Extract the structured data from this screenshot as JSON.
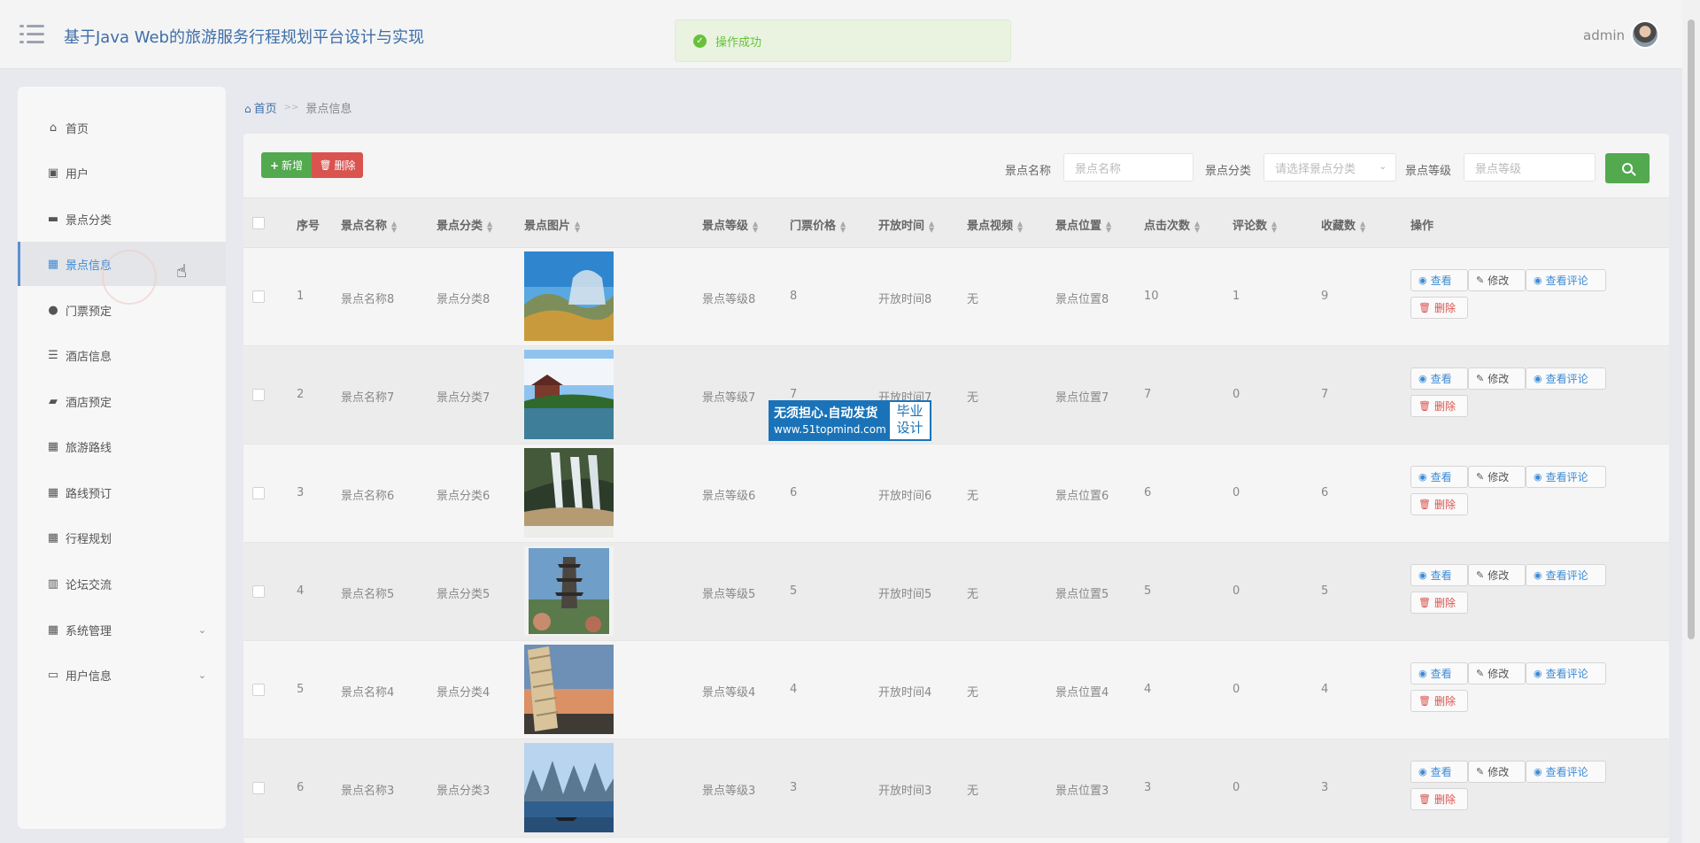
{
  "header": {
    "title": "基于Java Web的旅游服务行程规划平台设计与实现",
    "toast": "操作成功",
    "user": "admin"
  },
  "sidebar": {
    "items": [
      {
        "label": "首页",
        "icon": "home-icon",
        "glyph": "⌂"
      },
      {
        "label": "用户",
        "icon": "clipboard-icon",
        "glyph": "▣"
      },
      {
        "label": "景点分类",
        "icon": "monitor-icon",
        "glyph": "▬"
      },
      {
        "label": "景点信息",
        "icon": "grid-icon",
        "glyph": "▦",
        "active": true
      },
      {
        "label": "门票预定",
        "icon": "person-icon",
        "glyph": "●"
      },
      {
        "label": "酒店信息",
        "icon": "sliders-icon",
        "glyph": "☰"
      },
      {
        "label": "酒店预定",
        "icon": "ticket-icon",
        "glyph": "▰"
      },
      {
        "label": "旅游路线",
        "icon": "grid-icon",
        "glyph": "▦"
      },
      {
        "label": "路线预订",
        "icon": "grid-icon",
        "glyph": "▦"
      },
      {
        "label": "行程规划",
        "icon": "grid-icon",
        "glyph": "▦"
      },
      {
        "label": "论坛交流",
        "icon": "books-icon",
        "glyph": "▥"
      },
      {
        "label": "系统管理",
        "icon": "grid-icon",
        "glyph": "▦",
        "expandable": true
      },
      {
        "label": "用户信息",
        "icon": "card-icon",
        "glyph": "▭",
        "expandable": true
      }
    ]
  },
  "breadcrumb": {
    "home": "首页",
    "separator": ">>",
    "current": "景点信息"
  },
  "toolbar": {
    "add_label": "新增",
    "delete_label": "删除",
    "filters": [
      {
        "label": "景点名称",
        "placeholder": "景点名称"
      },
      {
        "label": "景点分类",
        "placeholder": "请选择景点分类"
      },
      {
        "label": "景点等级",
        "placeholder": "景点等级"
      }
    ]
  },
  "table": {
    "columns": [
      "序号",
      "景点名称",
      "景点分类",
      "景点图片",
      "景点等级",
      "门票价格",
      "开放时间",
      "景点视频",
      "景点位置",
      "点击次数",
      "评论数",
      "收藏数",
      "操作"
    ],
    "rows": [
      {
        "index": "1",
        "name": "景点名称8",
        "category": "景点分类8",
        "level": "景点等级8",
        "price": "8",
        "hours": "开放时间8",
        "video": "无",
        "location": "景点位置8",
        "clicks": "10",
        "comments": "1",
        "favorites": "9"
      },
      {
        "index": "2",
        "name": "景点名称7",
        "category": "景点分类7",
        "level": "景点等级7",
        "price": "7",
        "hours": "开放时间7",
        "video": "无",
        "location": "景点位置7",
        "clicks": "7",
        "comments": "0",
        "favorites": "7"
      },
      {
        "index": "3",
        "name": "景点名称6",
        "category": "景点分类6",
        "level": "景点等级6",
        "price": "6",
        "hours": "开放时间6",
        "video": "无",
        "location": "景点位置6",
        "clicks": "6",
        "comments": "0",
        "favorites": "6"
      },
      {
        "index": "4",
        "name": "景点名称5",
        "category": "景点分类5",
        "level": "景点等级5",
        "price": "5",
        "hours": "开放时间5",
        "video": "无",
        "location": "景点位置5",
        "clicks": "5",
        "comments": "0",
        "favorites": "5"
      },
      {
        "index": "5",
        "name": "景点名称4",
        "category": "景点分类4",
        "level": "景点等级4",
        "price": "4",
        "hours": "开放时间4",
        "video": "无",
        "location": "景点位置4",
        "clicks": "4",
        "comments": "0",
        "favorites": "4"
      },
      {
        "index": "6",
        "name": "景点名称3",
        "category": "景点分类3",
        "level": "景点等级3",
        "price": "3",
        "hours": "开放时间3",
        "video": "无",
        "location": "景点位置3",
        "clicks": "3",
        "comments": "0",
        "favorites": "3"
      }
    ],
    "actions": {
      "view": "查看",
      "edit": "修改",
      "view_comments": "查看评论",
      "delete": "删除"
    }
  },
  "watermark": {
    "line1": "无须担心.自动发货",
    "line2": "www.51topmind.com",
    "badge_top": "毕业",
    "badge_bottom": "设计"
  },
  "colors": {
    "primary": "#3d8bd6",
    "success": "#52a94e",
    "danger": "#d9534f",
    "title": "#3d6ea8"
  }
}
